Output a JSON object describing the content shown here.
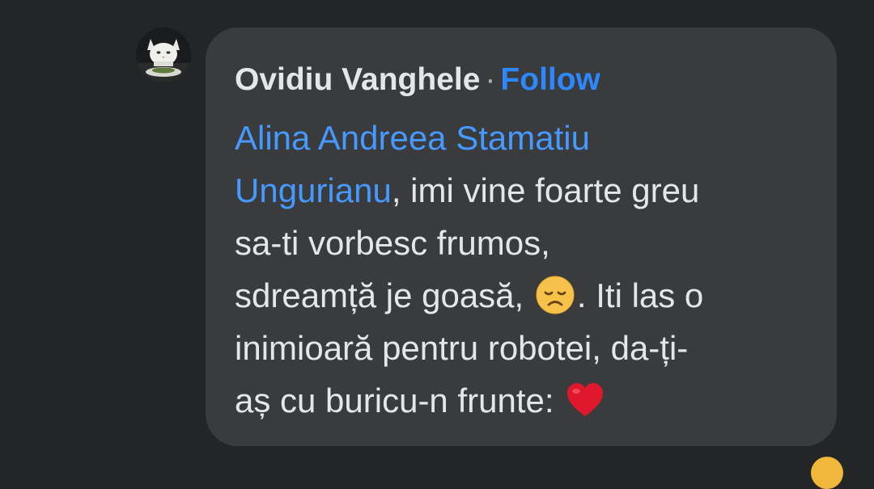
{
  "comment": {
    "author": "Ovidiu Vanghele",
    "separator": "·",
    "follow_label": "Follow",
    "mention_line1": "Alina Andreea Stamatiu",
    "mention_line2": "Ungurianu",
    "text_after_mention": ", imi vine foarte greu",
    "line3": "sa-ti vorbesc frumos,",
    "line4_before_emoji": "sdreamță je goasă,",
    "line4_after_emoji": ". Iti las o",
    "line5": "inimioară pentru robotei, da-ți-",
    "line6_before_emoji": "aș cu buricu-n frunte:",
    "emoji_1": "disappointed-face",
    "emoji_2": "red-heart"
  },
  "colors": {
    "background": "#242526",
    "bubble": "#3a3b3c",
    "text": "#e4e6eb",
    "link": "#4599ff",
    "follow": "#2d88ff"
  }
}
